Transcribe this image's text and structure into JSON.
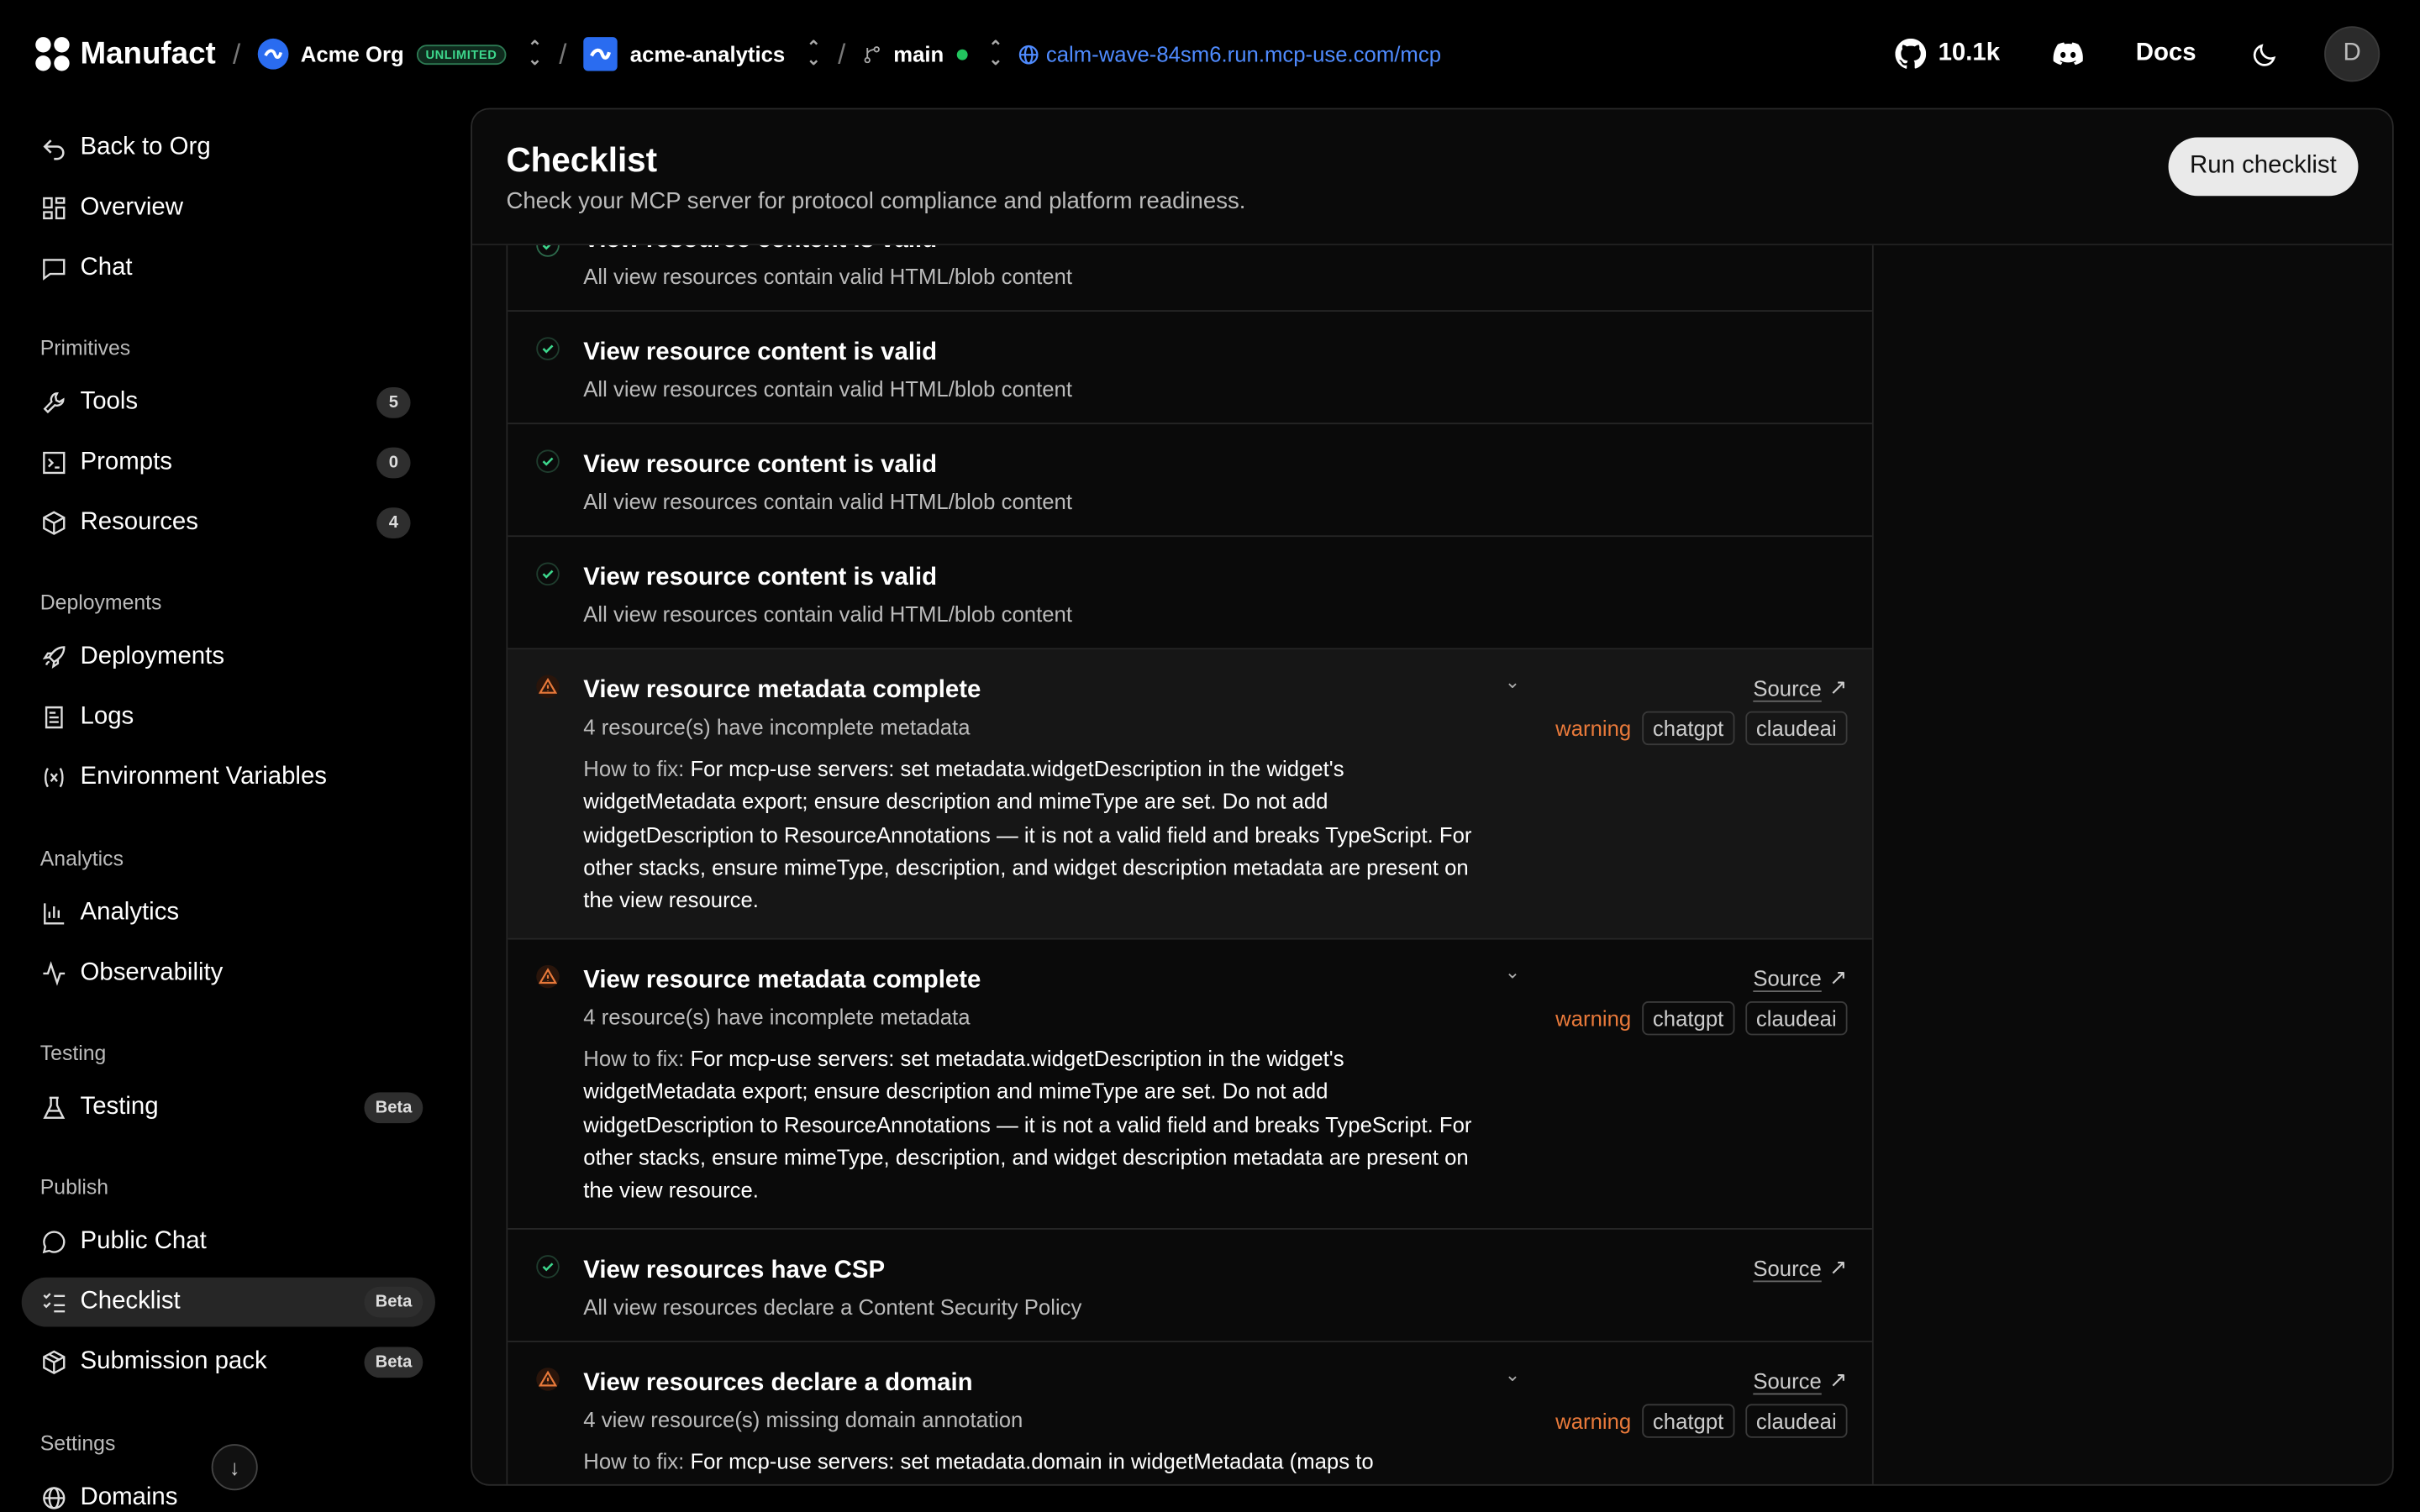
{
  "topbar": {
    "brand": "Manufact",
    "org_name": "Acme Org",
    "org_badge": "UNLIMITED",
    "project_name": "acme-analytics",
    "branch": "main",
    "server_url": "calm-wave-84sm6.run.mcp-use.com/mcp",
    "github_stars": "10.1k",
    "docs_label": "Docs",
    "avatar_initial": "D",
    "separator": "/"
  },
  "sidebar": {
    "back": "Back to Org",
    "overview": "Overview",
    "chat": "Chat",
    "sections": {
      "primitives": "Primitives",
      "deployments": "Deployments",
      "analytics": "Analytics",
      "testing": "Testing",
      "publish": "Publish",
      "settings": "Settings"
    },
    "tools": {
      "label": "Tools",
      "count": "5"
    },
    "prompts": {
      "label": "Prompts",
      "count": "0"
    },
    "resources": {
      "label": "Resources",
      "count": "4"
    },
    "deployments_item": "Deployments",
    "logs": "Logs",
    "env_vars": "Environment Variables",
    "analytics_item": "Analytics",
    "observability": "Observability",
    "testing_item": {
      "label": "Testing",
      "badge": "Beta"
    },
    "public_chat": "Public Chat",
    "checklist": {
      "label": "Checklist",
      "badge": "Beta"
    },
    "submission_pack": {
      "label": "Submission pack",
      "badge": "Beta"
    },
    "domains": "Domains"
  },
  "panel": {
    "title": "Checklist",
    "subtitle": "Check your MCP server for protocol compliance and platform readiness.",
    "run_button": "Run checklist"
  },
  "checks": [
    {
      "title": "View resource content is valid",
      "desc": "All view resources contain valid HTML/blob content",
      "status": "pass"
    },
    {
      "title": "View resource content is valid",
      "desc": "All view resources contain valid HTML/blob content",
      "status": "pass"
    },
    {
      "title": "View resource content is valid",
      "desc": "All view resources contain valid HTML/blob content",
      "status": "pass"
    },
    {
      "title": "View resource content is valid",
      "desc": "All view resources contain valid HTML/blob content",
      "status": "pass"
    },
    {
      "title": "View resource metadata complete",
      "desc": "4 resource(s) have incomplete metadata",
      "status": "warning",
      "fix_label": "How to fix:",
      "fix": "For mcp-use servers: set metadata.widgetDescription in the widget's widgetMetadata export; ensure description and mimeType are set. Do not add widgetDescription to ResourceAnnotations — it is not a valid field and breaks TypeScript. For other stacks, ensure mimeType, description, and widget description metadata are present on the view resource.",
      "source": "Source",
      "severity": "warning",
      "tags": [
        "chatgpt",
        "claudeai"
      ]
    },
    {
      "title": "View resource metadata complete",
      "desc": "4 resource(s) have incomplete metadata",
      "status": "warning",
      "fix_label": "How to fix:",
      "fix": "For mcp-use servers: set metadata.widgetDescription in the widget's widgetMetadata export; ensure description and mimeType are set. Do not add widgetDescription to ResourceAnnotations — it is not a valid field and breaks TypeScript. For other stacks, ensure mimeType, description, and widget description metadata are present on the view resource.",
      "source": "Source",
      "severity": "warning",
      "tags": [
        "chatgpt",
        "claudeai"
      ]
    },
    {
      "title": "View resources have CSP",
      "desc": "All view resources declare a Content Security Policy",
      "status": "pass",
      "source": "Source"
    },
    {
      "title": "View resources declare a domain",
      "desc": "4 view resource(s) missing domain annotation",
      "status": "warning",
      "fix_label": "How to fix:",
      "fix": "For mcp-use servers: set metadata.domain in widgetMetadata (maps to",
      "source": "Source",
      "severity": "warning",
      "tags": [
        "chatgpt",
        "claudeai"
      ]
    }
  ],
  "colors": {
    "accent": "#4f8bff",
    "warning": "#e8793a",
    "pass": "#3dd68c",
    "badge_green": "#3dd68c"
  }
}
